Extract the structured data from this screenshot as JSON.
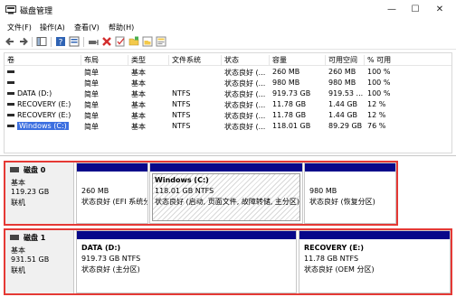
{
  "window": {
    "title": "磁盘管理",
    "minimize_glyph": "—",
    "maximize_glyph": "☐",
    "close_glyph": "✕"
  },
  "menu": [
    "文件(F)",
    "操作(A)",
    "查看(V)",
    "帮助(H)"
  ],
  "toolbar": {
    "icons": [
      "back-icon",
      "forward-icon",
      "console-tree-icon",
      "help-icon",
      "properties-icon",
      "connect-disk-icon",
      "delete-icon",
      "check-icon",
      "new-folder-icon",
      "folder-open-icon",
      "properties-sheet-icon"
    ]
  },
  "volume_list": {
    "headers": [
      "卷",
      "布局",
      "类型",
      "文件系统",
      "状态",
      "容量",
      "可用空间",
      "% 可用"
    ],
    "rows": [
      {
        "name": "",
        "layout": "简单",
        "type": "基本",
        "fs": "",
        "status": "状态良好 (...",
        "capacity": "260 MB",
        "free": "260 MB",
        "pct": "100 %"
      },
      {
        "name": "",
        "layout": "简单",
        "type": "基本",
        "fs": "",
        "status": "状态良好 (...",
        "capacity": "980 MB",
        "free": "980 MB",
        "pct": "100 %"
      },
      {
        "name": "DATA (D:)",
        "layout": "简单",
        "type": "基本",
        "fs": "NTFS",
        "status": "状态良好 (...",
        "capacity": "919.73 GB",
        "free": "919.53 ...",
        "pct": "100 %"
      },
      {
        "name": "RECOVERY (E:)",
        "layout": "简单",
        "type": "基本",
        "fs": "NTFS",
        "status": "状态良好 (...",
        "capacity": "11.78 GB",
        "free": "1.44 GB",
        "pct": "12 %"
      },
      {
        "name": "RECOVERY (E:)",
        "layout": "简单",
        "type": "基本",
        "fs": "NTFS",
        "status": "状态良好 (...",
        "capacity": "11.78 GB",
        "free": "1.44 GB",
        "pct": "12 %"
      },
      {
        "name": "Windows (C:)",
        "layout": "简单",
        "type": "基本",
        "fs": "NTFS",
        "status": "状态良好 (...",
        "capacity": "118.01 GB",
        "free": "89.29 GB",
        "pct": "76 %"
      }
    ]
  },
  "disks": [
    {
      "name": "磁盘 0",
      "type": "基本",
      "size": "119.23 GB",
      "status": "联机",
      "partitions": [
        {
          "title": "",
          "size": "260 MB",
          "status": "状态良好 (EFI 系统分"
        },
        {
          "title": "Windows  (C:)",
          "size": "118.01 GB NTFS",
          "status": "状态良好 (启动, 页面文件, 故障转储, 主分区)"
        },
        {
          "title": "",
          "size": "980 MB",
          "status": "状态良好 (恢复分区)"
        }
      ]
    },
    {
      "name": "磁盘 1",
      "type": "基本",
      "size": "931.51 GB",
      "status": "联机",
      "partitions": [
        {
          "title": "DATA  (D:)",
          "size": "919.73 GB NTFS",
          "status": "状态良好 (主分区)"
        },
        {
          "title": "RECOVERY  (E:)",
          "size": "11.78 GB NTFS",
          "status": "状态良好 (OEM 分区)"
        }
      ]
    }
  ],
  "colors": {
    "partition_bar": "#08088a",
    "highlight_border": "#e53935",
    "selection": "#3c6fe0"
  }
}
